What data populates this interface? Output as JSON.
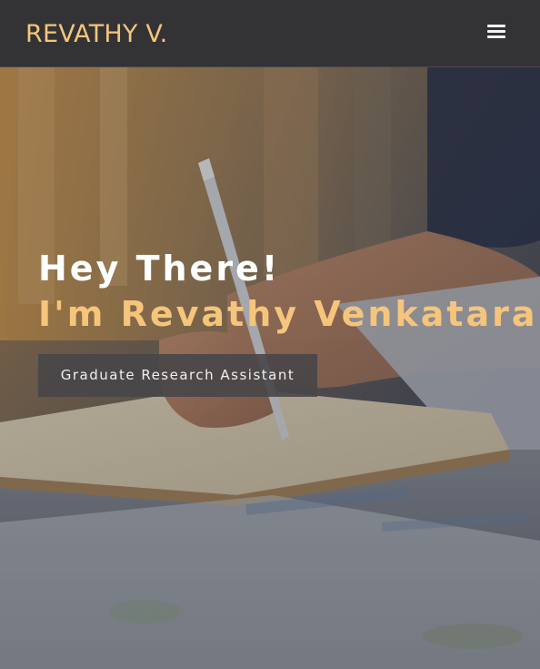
{
  "navbar": {
    "brand": "REVATHY V.",
    "menu_icon": "hamburger-menu-icon"
  },
  "hero": {
    "greeting": "Hey There!",
    "name_line": "I'm Revathy Venkataram",
    "role_button": "Graduate Research Assistant",
    "background_image": "person-writing-in-notebook-with-pen",
    "colors": {
      "accent": "#f5c57c",
      "navbar": "#333335",
      "button": "#484648"
    }
  }
}
